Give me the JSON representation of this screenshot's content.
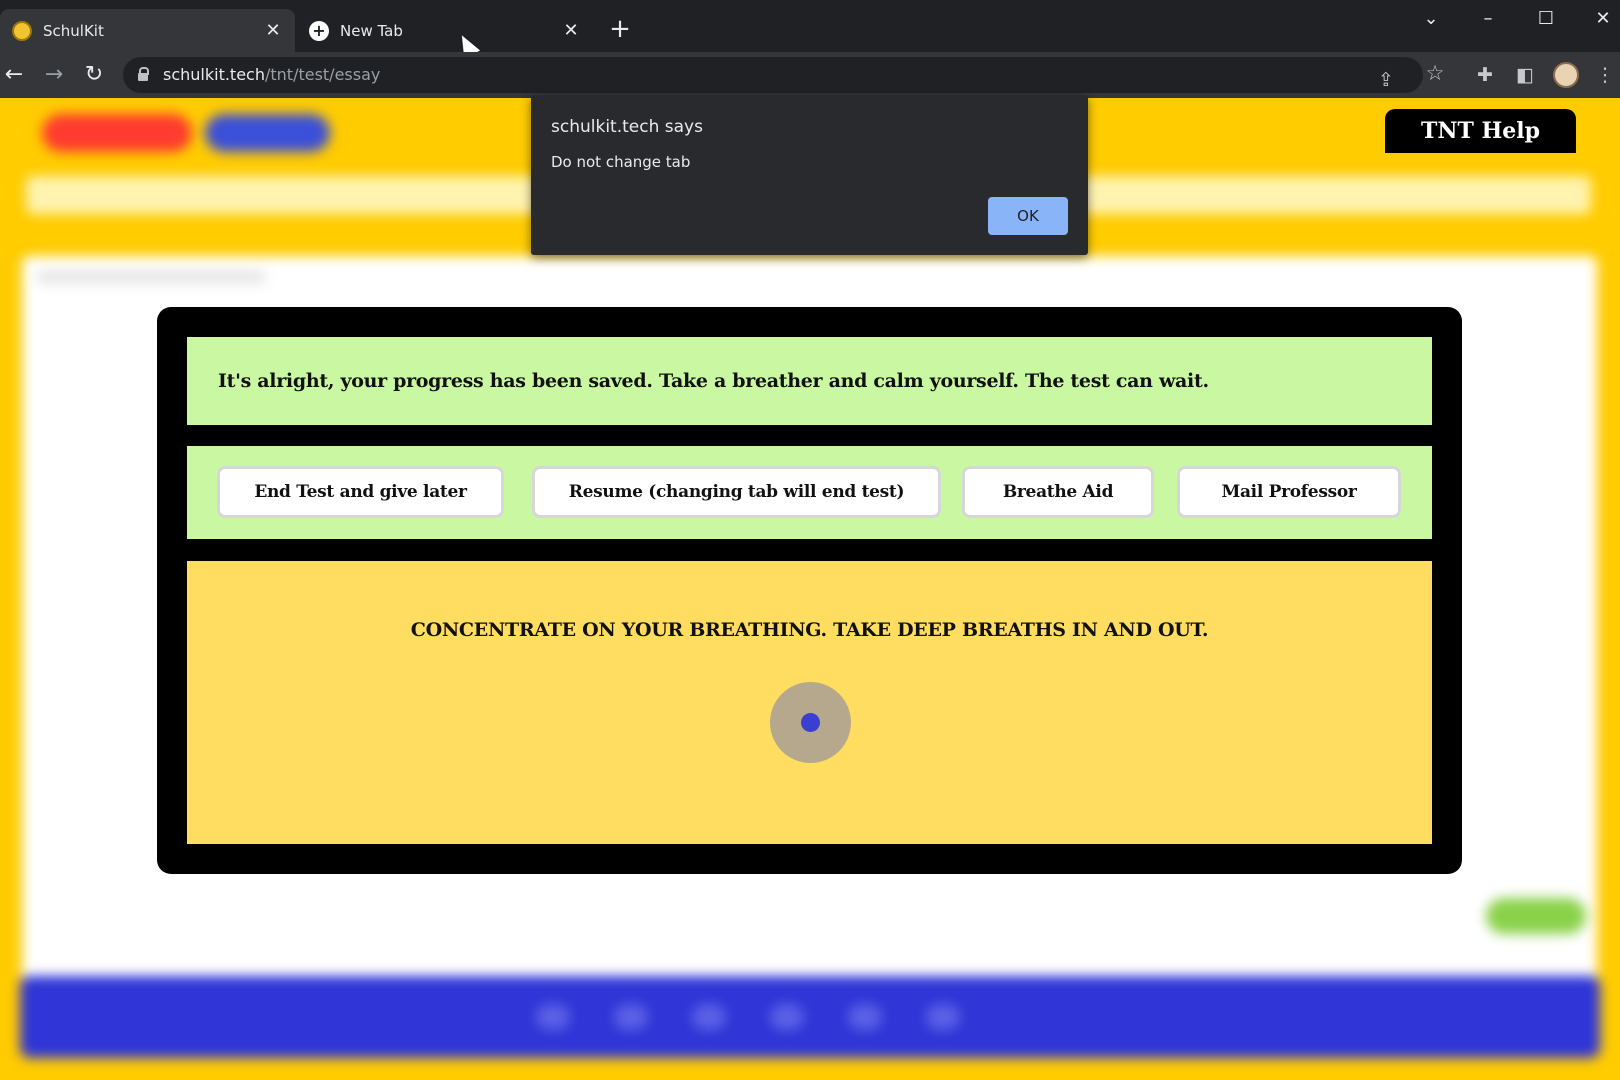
{
  "browser": {
    "tabs": [
      {
        "title": "SchulKit",
        "active": true
      },
      {
        "title": "New Tab",
        "active": false
      }
    ],
    "address": {
      "host": "schulkit.tech",
      "path": "/tnt/test/essay"
    }
  },
  "page": {
    "help_label": "TNT Help"
  },
  "dialog": {
    "title": "schulkit.tech says",
    "message": "Do not change tab",
    "ok_label": "OK"
  },
  "modal": {
    "message": "It's alright, your progress has been saved. Take a breather and calm yourself. The test can wait.",
    "buttons": {
      "end_test": "End Test and give later",
      "resume": "Resume (changing tab will end test)",
      "breathe_aid": "Breathe Aid",
      "mail_professor": "Mail Professor"
    },
    "breathing_instruction": "CONCENTRATE ON YOUR BREATHING. TAKE DEEP BREATHS IN AND OUT."
  },
  "colors": {
    "page_background": "#ffcc00",
    "panel_green": "#caf7a2",
    "breath_panel": "#ffdd60",
    "breath_circle": "#b5a88d",
    "breath_dot": "#3b3fd1",
    "dialog_button": "#8ab4f8"
  }
}
